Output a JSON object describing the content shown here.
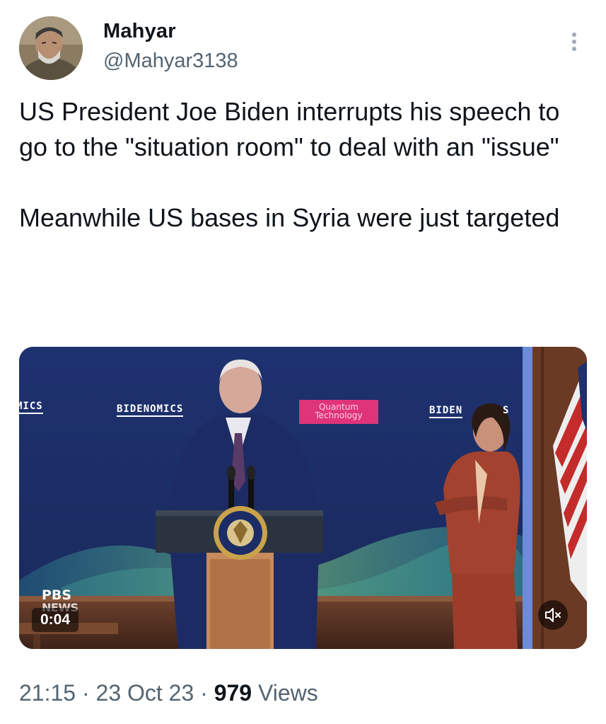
{
  "author": {
    "name": "Mahyar",
    "handle": "@Mahyar3138"
  },
  "tweet": {
    "paragraph1": "US President Joe Biden interrupts his speech to go to the \"situation room\" to deal with an \"issue\"",
    "paragraph2": "Meanwhile US bases in Syria were just targeted"
  },
  "video": {
    "banner_left": "MICS",
    "banner_center": "BIDENOMICS",
    "banner_right": "BIDEN",
    "banner_right_tail": "S",
    "quantum_line1": "Quantum",
    "quantum_line2": "Technology",
    "watermark_top": "PBS",
    "watermark_bottom": "NEWS",
    "duration": "0:04"
  },
  "meta": {
    "time": "21:15",
    "separator": "·",
    "date": "23 Oct 23",
    "views_count": "979",
    "views_label": "Views"
  },
  "icons": {
    "more": "more-vertical-icon",
    "mute": "speaker-muted-icon"
  }
}
